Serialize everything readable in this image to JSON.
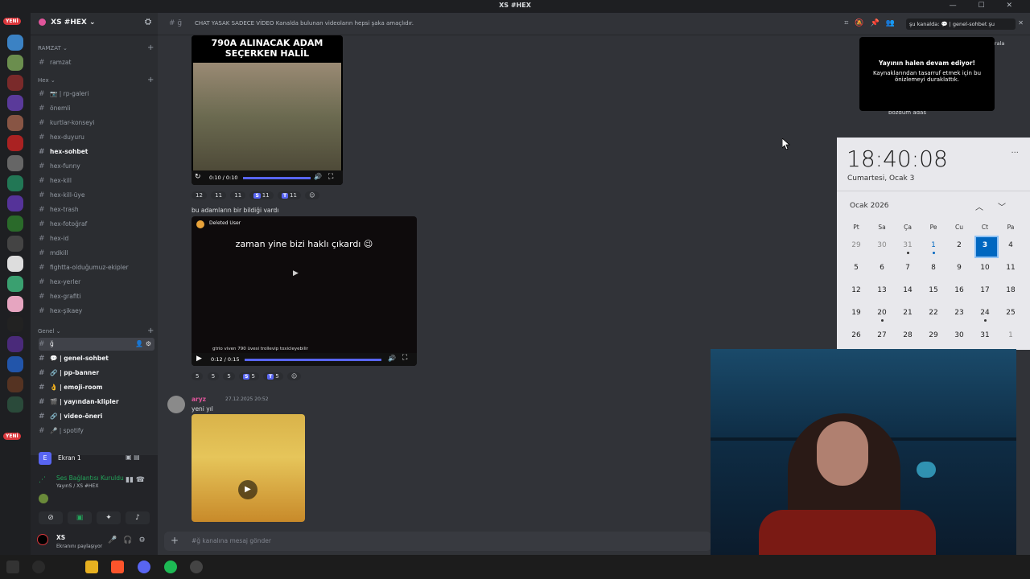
{
  "window": {
    "title": "XS #HEX"
  },
  "guild_badges": {
    "top": "YENİ",
    "bottom": "YENİ"
  },
  "server": {
    "name": "XS #HEX ⌄"
  },
  "categories": [
    {
      "label": "RAMZAT ⌄"
    },
    {
      "label": "Hex ⌄"
    },
    {
      "label": "Genel ⌄"
    }
  ],
  "channels": [
    {
      "label": "ramzat"
    },
    {
      "label": "📷 | rp-galeri"
    },
    {
      "label": "önemli"
    },
    {
      "label": "kurtlar-konseyi"
    },
    {
      "label": "hex-duyuru"
    },
    {
      "label": "hex-sohbet"
    },
    {
      "label": "hex-funny"
    },
    {
      "label": "hex-kill"
    },
    {
      "label": "hex-kill-üye"
    },
    {
      "label": "hex-trash"
    },
    {
      "label": "hex-fotoğraf"
    },
    {
      "label": "hex-id"
    },
    {
      "label": "mdkill"
    },
    {
      "label": "fightta-olduğumuz-ekipler"
    },
    {
      "label": "hex-yerler"
    },
    {
      "label": "hex-grafiti"
    },
    {
      "label": "hex-şikaey"
    },
    {
      "label": "ğ"
    },
    {
      "label": "💬 | genel-sohbet"
    },
    {
      "label": "🔗 | pp-banner"
    },
    {
      "label": "👌 | emoji-room"
    },
    {
      "label": "🎬 | yayından-klipler"
    },
    {
      "label": "🔗 | video-öneri"
    },
    {
      "label": "🎤 | spotify"
    }
  ],
  "panel": {
    "screen_label": "Ekran 1",
    "voice_status": "Ses Bağlantısı Kuruldu",
    "voice_channel": "YayınS / XS #HEX",
    "user_name": "XS",
    "user_status": "Ekranını paylaşıyor"
  },
  "header": {
    "channel": "ğ",
    "topic": "CHAT YASAK SADECE VİDEO Kanalda bulunan videoların hepsi şaka amaçlıdır.",
    "search_text": "şu kanalda: 💬 | genel-sohbet  şu"
  },
  "messages": {
    "video1_caption": "790A ALINACAK ADAM SEÇERKEN HALİL",
    "video1_time": "0:10 / 0:10",
    "reactions1": [
      "12",
      "11",
      "11",
      "11",
      "11"
    ],
    "text2": "bu adamların bir bildiği vardı",
    "video2_user": "Deleted User",
    "video2_overlay": "zaman yine bizi haklı çıkardı 😉",
    "video2_subtext": "gtrio viven 790 üvesi trollevip toxicleyebilir",
    "video2_time": "0:12 / 0:15",
    "reactions2": [
      "5",
      "5",
      "5",
      "5",
      "5"
    ],
    "author3": "aryz",
    "timestamp3": "27.12.2025 20:52",
    "text3": "yeni yıl"
  },
  "input": {
    "placeholder": "#ğ kanalına mesaj gönder"
  },
  "stream_tooltip": {
    "heading": "Yayının halen devam ediyor!",
    "body": "Kaynaklarından tasarruf etmek için bu önizlemeyi duraklattık."
  },
  "side_overlay": {
    "sort_label": "Sırala",
    "text": "bozdum adas"
  },
  "clock": {
    "time": "18:40:08",
    "date": "Cumartesi, Ocak 3",
    "month": "Ocak 2026",
    "weekdays": [
      "Pt",
      "Sa",
      "Ça",
      "Pe",
      "Cu",
      "Ct",
      "Pa"
    ],
    "weeks": [
      [
        "29",
        "30",
        "31",
        "1",
        "2",
        "3",
        "4"
      ],
      [
        "5",
        "6",
        "7",
        "8",
        "9",
        "10",
        "11"
      ],
      [
        "12",
        "13",
        "14",
        "15",
        "16",
        "17",
        "18"
      ],
      [
        "19",
        "20",
        "21",
        "22",
        "23",
        "24",
        "25"
      ],
      [
        "26",
        "27",
        "28",
        "29",
        "30",
        "31",
        "1"
      ]
    ],
    "today": "3"
  },
  "icons": [
    "search-icon",
    "settings-icon",
    "mic-icon",
    "headphones-icon",
    "phone-icon",
    "chevron-up-icon",
    "chevron-down-icon"
  ]
}
